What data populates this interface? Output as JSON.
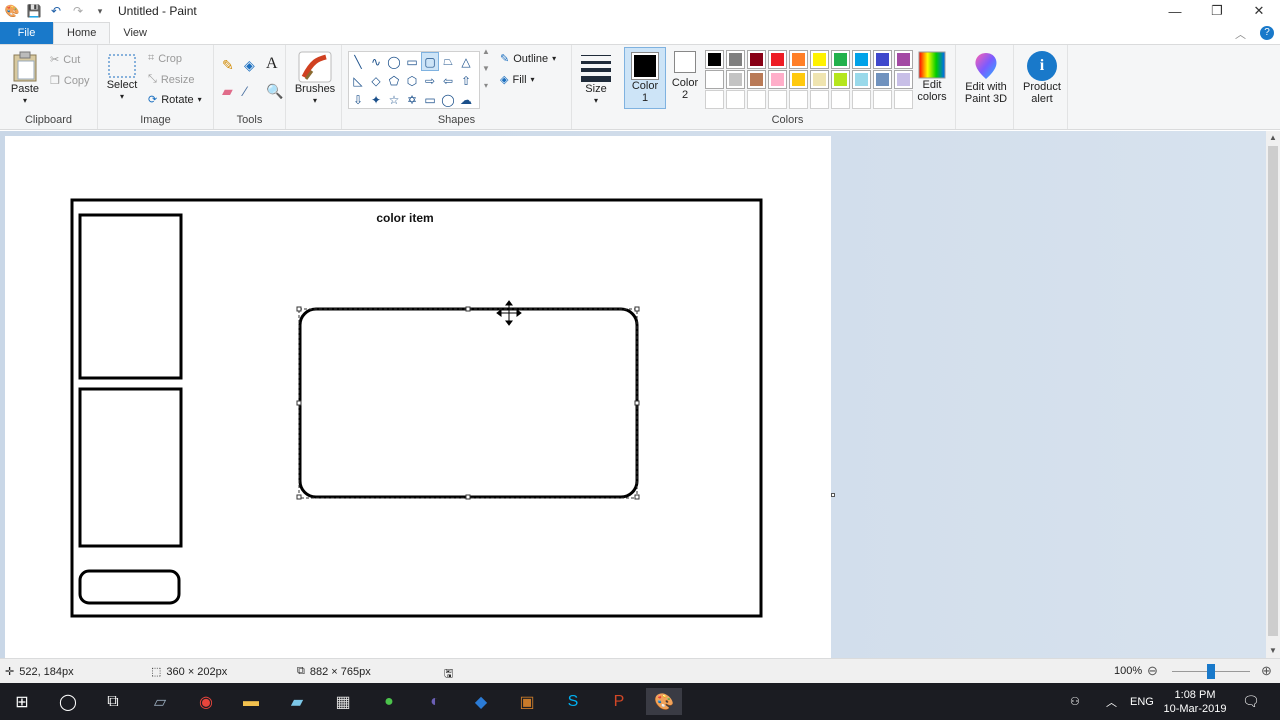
{
  "window": {
    "title": "Untitled - Paint",
    "minimize_icon": "minimize-icon",
    "restore_icon": "restore-icon",
    "close_icon": "close-icon"
  },
  "quick_access": [
    "paint-app-icon",
    "save-icon",
    "undo-icon",
    "redo-icon",
    "customize-dropdown-icon"
  ],
  "tabs": [
    {
      "label": "File"
    },
    {
      "label": "Home"
    },
    {
      "label": "View"
    }
  ],
  "ribbon": {
    "clipboard": {
      "label": "Clipboard",
      "paste": "Paste",
      "cut": "Cut",
      "copy": "Copy"
    },
    "image": {
      "label": "Image",
      "select": "Select",
      "crop": "Crop",
      "resize": "Resize",
      "rotate": "Rotate"
    },
    "tools": {
      "label": "Tools"
    },
    "brushes": {
      "label": "Brushes"
    },
    "shapes": {
      "label": "Shapes",
      "outline": "Outline",
      "fill": "Fill"
    },
    "size": {
      "label": "Size"
    },
    "colors": {
      "label": "Colors",
      "color1_line1": "Color",
      "color1_line2": "1",
      "color2_line1": "Color",
      "color2_line2": "2",
      "edit_colors_line1": "Edit",
      "edit_colors_line2": "colors",
      "swatches_row1": [
        "#000000",
        "#7f7f7f",
        "#880015",
        "#ed1c24",
        "#ff7f27",
        "#fff200",
        "#22b14c",
        "#00a2e8",
        "#3f48cc",
        "#a349a4"
      ],
      "swatches_row2": [
        "#ffffff",
        "#c3c3c3",
        "#b97a57",
        "#ffaec9",
        "#ffc90e",
        "#efe4b0",
        "#b5e61d",
        "#99d9ea",
        "#7092be",
        "#c8bfe7"
      ],
      "swatches_row3": [
        "#ffffff",
        "#ffffff",
        "#ffffff",
        "#ffffff",
        "#ffffff",
        "#ffffff",
        "#ffffff",
        "#ffffff",
        "#ffffff",
        "#ffffff"
      ],
      "color1_value": "#000000",
      "color2_value": "#ffffff"
    },
    "paint3d": {
      "line1": "Edit with",
      "line2": "Paint 3D"
    },
    "product_alert": {
      "line1": "Product",
      "line2": "alert"
    }
  },
  "drawing": {
    "heading": "color item"
  },
  "status": {
    "cursor_pos": "522, 184px",
    "selection_size": "360 × 202px",
    "image_size": "882 × 765px",
    "zoom": "100%"
  },
  "taskbar": {
    "apps": [
      "windows-start-icon",
      "cortana-search-icon",
      "task-view-icon",
      "app-icon",
      "chrome-icon",
      "file-explorer-icon",
      "notepad-icon",
      "calculator-icon",
      "app-green-icon",
      "eclipse-icon",
      "vscode-icon",
      "app-icon-2",
      "skype-icon",
      "powerpoint-icon",
      "paint-icon"
    ],
    "lang": "ENG",
    "time": "1:08 PM",
    "date": "10-Mar-2019"
  }
}
